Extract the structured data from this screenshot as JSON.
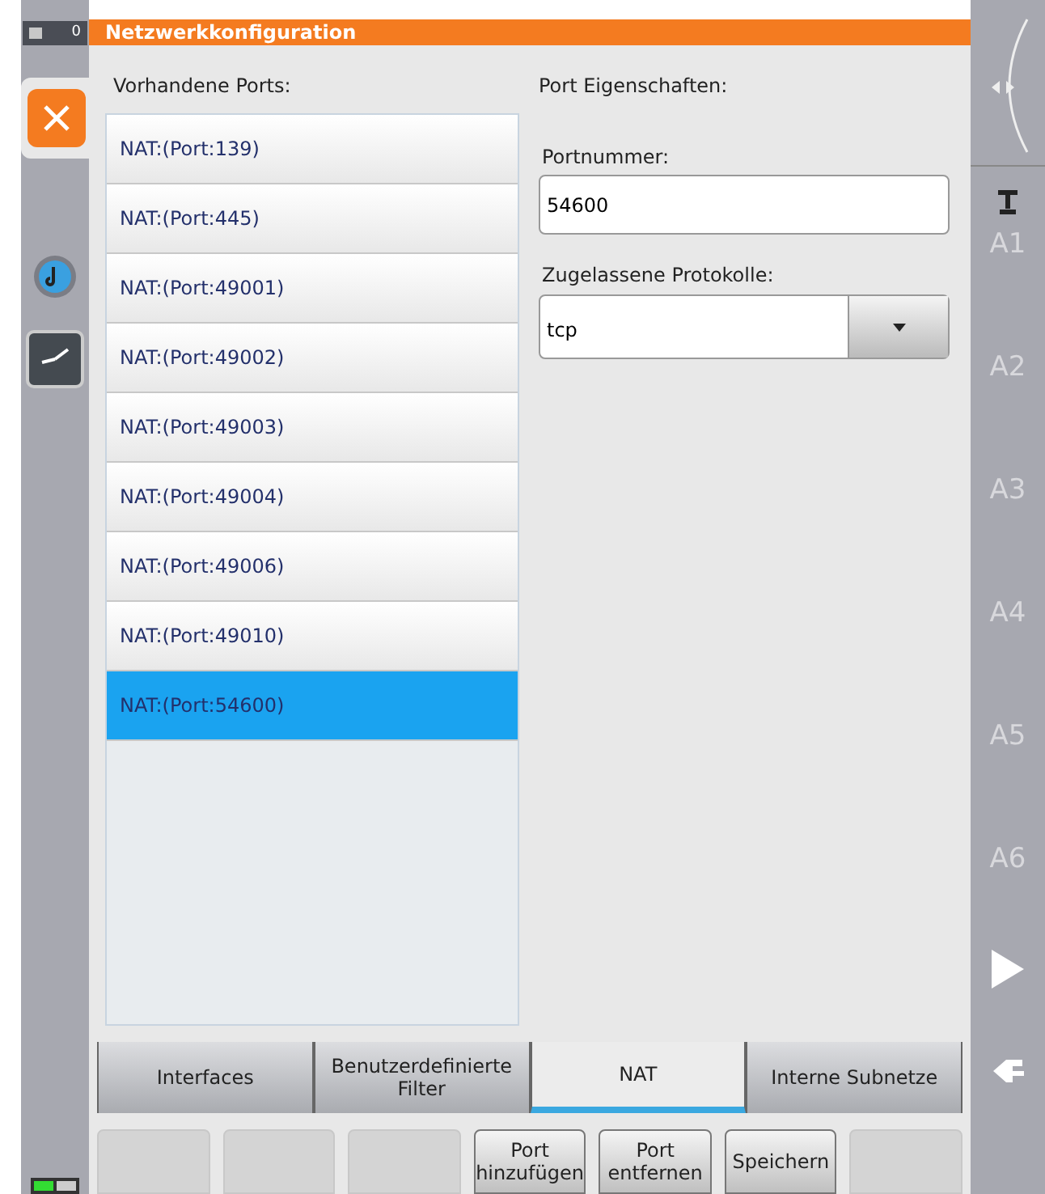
{
  "status_indicator": {
    "count": "0"
  },
  "window": {
    "title": "Netzwerkkonfiguration"
  },
  "ports": {
    "label": "Vorhandene Ports:",
    "items": [
      {
        "label": "NAT:(Port:139)",
        "selected": false
      },
      {
        "label": "NAT:(Port:445)",
        "selected": false
      },
      {
        "label": "NAT:(Port:49001)",
        "selected": false
      },
      {
        "label": "NAT:(Port:49002)",
        "selected": false
      },
      {
        "label": "NAT:(Port:49003)",
        "selected": false
      },
      {
        "label": "NAT:(Port:49004)",
        "selected": false
      },
      {
        "label": "NAT:(Port:49006)",
        "selected": false
      },
      {
        "label": "NAT:(Port:49010)",
        "selected": false
      },
      {
        "label": "NAT:(Port:54600)",
        "selected": true
      }
    ]
  },
  "properties": {
    "title": "Port Eigenschaften:",
    "port_label": "Portnummer:",
    "port_value": "54600",
    "protocol_label": "Zugelassene Protokolle:",
    "protocol_value": "tcp"
  },
  "tabs": [
    {
      "label": "Interfaces",
      "selected": false
    },
    {
      "label": "Benutzerdefinierte Filter",
      "selected": false
    },
    {
      "label": "NAT",
      "selected": true
    },
    {
      "label": "Interne Subnetze",
      "selected": false
    }
  ],
  "buttons": [
    {
      "kind": "blank"
    },
    {
      "kind": "blank"
    },
    {
      "kind": "blank"
    },
    {
      "kind": "action",
      "label": "Port hinzufügen"
    },
    {
      "kind": "action",
      "label": "Port entfernen"
    },
    {
      "kind": "action",
      "label": "Speichern"
    },
    {
      "kind": "blank"
    }
  ],
  "axes": [
    "A1",
    "A2",
    "A3",
    "A4",
    "A5",
    "A6"
  ]
}
